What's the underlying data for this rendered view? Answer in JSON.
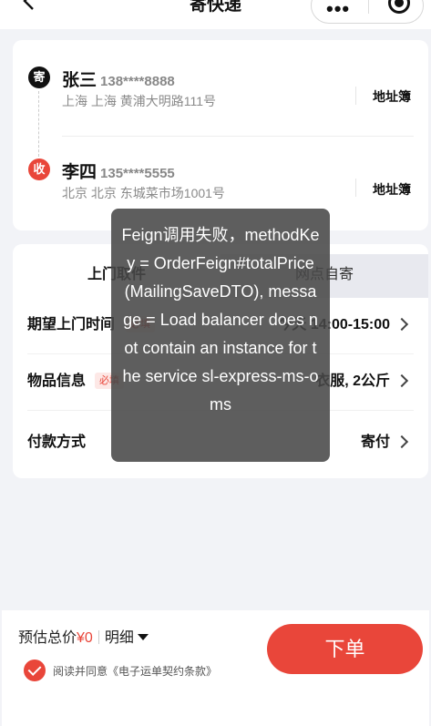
{
  "header": {
    "title": "寄快递"
  },
  "sender": {
    "badge": "寄",
    "name": "张三",
    "phone": "138****8888",
    "address": "上海 上海 黄浦大明路111号",
    "book_label": "地址簿"
  },
  "receiver": {
    "badge": "收",
    "name": "李四",
    "phone": "135****5555",
    "address": "北京 北京 东城菜市场1001号",
    "book_label": "地址簿"
  },
  "tabs": [
    {
      "label": "上门取件",
      "active": true
    },
    {
      "label": "网点自寄",
      "active": false
    }
  ],
  "rows": [
    {
      "label": "期望上门时间",
      "required": "必填",
      "value": "今天 14:00-15:00"
    },
    {
      "label": "物品信息",
      "required": "必填",
      "value": "衣服, 2公斤"
    },
    {
      "label": "付款方式",
      "value": "寄付"
    }
  ],
  "bottom": {
    "price_label": "预估总价",
    "price_value": "¥0",
    "detail_label": "明细",
    "submit_label": "下单",
    "agree_text": "阅读并同意《电子运单契约条款》"
  },
  "toast": {
    "message": "Feign调用失败，methodKey = OrderFeign#totalPrice(MailingSaveDTO), message = Load balancer does not contain an instance for the service sl-express-ms-oms"
  },
  "colors": {
    "accent": "#e9463a",
    "background": "#f2f3f7"
  }
}
